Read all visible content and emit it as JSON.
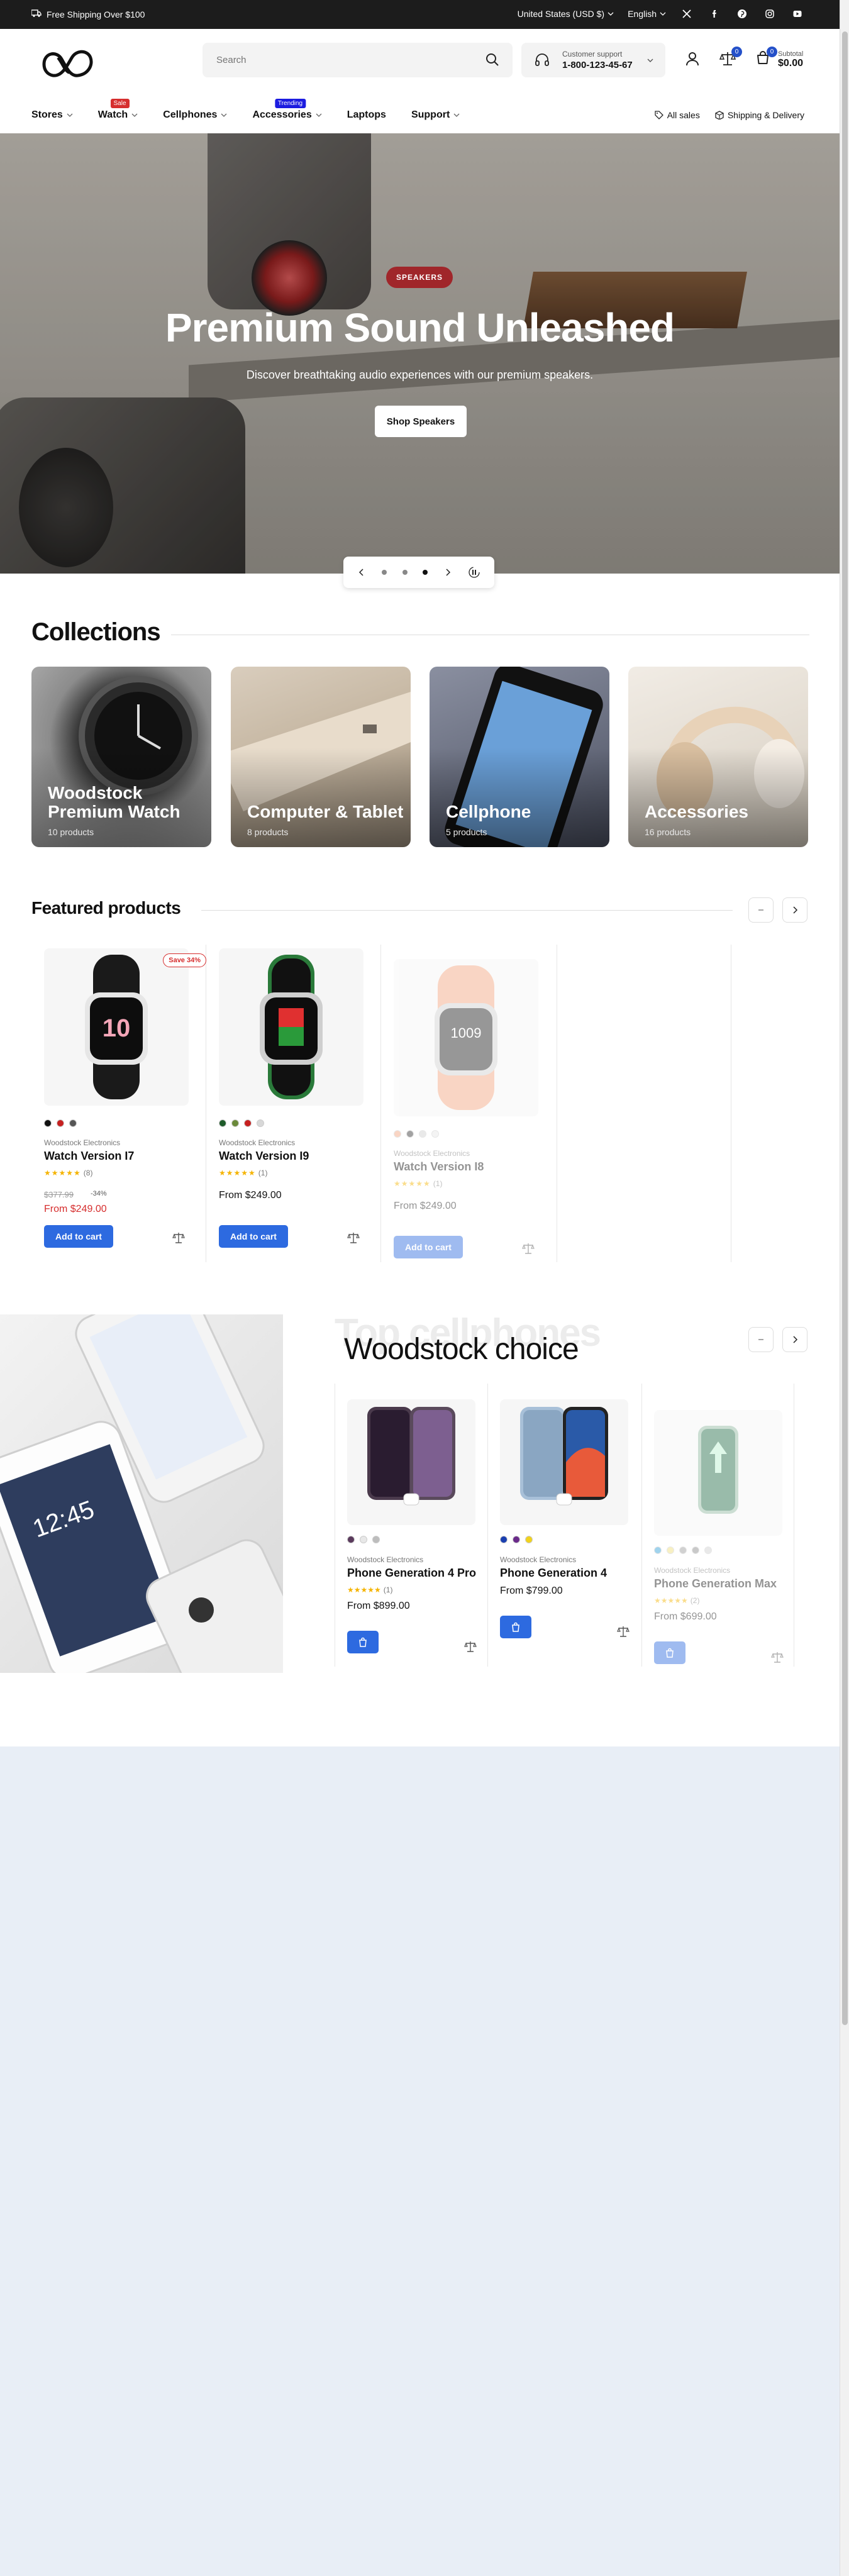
{
  "announcement": {
    "shipping": "Free Shipping Over $100",
    "currency": "United States (USD $)",
    "language": "English"
  },
  "header": {
    "search_placeholder": "Search",
    "support_label": "Customer support",
    "support_phone": "1-800-123-45-67",
    "compare_count": "0",
    "cart_count": "0",
    "subtotal_label": "Subtotal",
    "subtotal_value": "$0.00"
  },
  "nav": {
    "items": [
      {
        "label": "Stores"
      },
      {
        "label": "Watch",
        "tag": "Sale"
      },
      {
        "label": "Cellphones"
      },
      {
        "label": "Accessories",
        "tag": "Trending"
      },
      {
        "label": "Laptops"
      },
      {
        "label": "Support"
      }
    ],
    "all_sales": "All sales",
    "shipping": "Shipping & Delivery"
  },
  "hero": {
    "pill": "SPEAKERS",
    "title": "Premium Sound Unleashed",
    "subtitle": "Discover breathtaking audio experiences with our premium speakers.",
    "cta": "Shop Speakers"
  },
  "collections": {
    "title": "Collections",
    "items": [
      {
        "name": "Woodstock Premium Watch",
        "count": "10 products"
      },
      {
        "name": "Computer & Tablet",
        "count": "8 products"
      },
      {
        "name": "Cellphone",
        "count": "5 products"
      },
      {
        "name": "Accessories",
        "count": "16 products"
      }
    ]
  },
  "featured": {
    "title": "Featured products",
    "products": [
      {
        "brand": "Woodstock Electronics",
        "name": "Watch Version I7",
        "reviews": "(8)",
        "old_price": "$377.99",
        "discount": "-34%",
        "price": "From $249.00",
        "save": "Save 34%",
        "add": "Add to cart",
        "swatches": [
          "#111111",
          "#c62020",
          "#555555"
        ]
      },
      {
        "brand": "Woodstock Electronics",
        "name": "Watch Version I9",
        "reviews": "(1)",
        "price": "From $249.00",
        "add": "Add to cart",
        "swatches": [
          "#1e5b2a",
          "#6b8a3a",
          "#c62020",
          "#d8d8d8"
        ]
      },
      {
        "brand": "Woodstock Electronics",
        "name": "Watch Version I8",
        "reviews": "(1)",
        "price": "From $249.00",
        "add": "Add to cart",
        "swatches": [
          "#f3a47d",
          "#333333",
          "#cfcfcf",
          "#e8e8e8"
        ]
      }
    ]
  },
  "choice": {
    "ghost": "Top cellphones",
    "title": "Woodstock choice",
    "products": [
      {
        "brand": "Woodstock Electronics",
        "name": "Phone Generation 4 Pro",
        "reviews": "(1)",
        "price": "From $899.00",
        "swatches": [
          "#5a3a5c",
          "#e8e8e8",
          "#bdbdbd"
        ]
      },
      {
        "brand": "Woodstock Electronics",
        "name": "Phone Generation 4",
        "reviews": "",
        "price": "From $799.00",
        "swatches": [
          "#1a3fb0",
          "#6a2a8a",
          "#f1d21c"
        ]
      },
      {
        "brand": "Woodstock Electronics",
        "name": "Phone Generation Max",
        "reviews": "(2)",
        "price": "From $699.00",
        "swatches": [
          "#2ea0d8",
          "#f1e07a",
          "#9a9a9a",
          "#8a8a8a",
          "#cfcfcf"
        ]
      }
    ]
  },
  "colors": {
    "accent": "#2d6ae0",
    "sale": "#d62e2e",
    "hero_pill": "#a0262a",
    "topbar": "#1c1c1c"
  }
}
